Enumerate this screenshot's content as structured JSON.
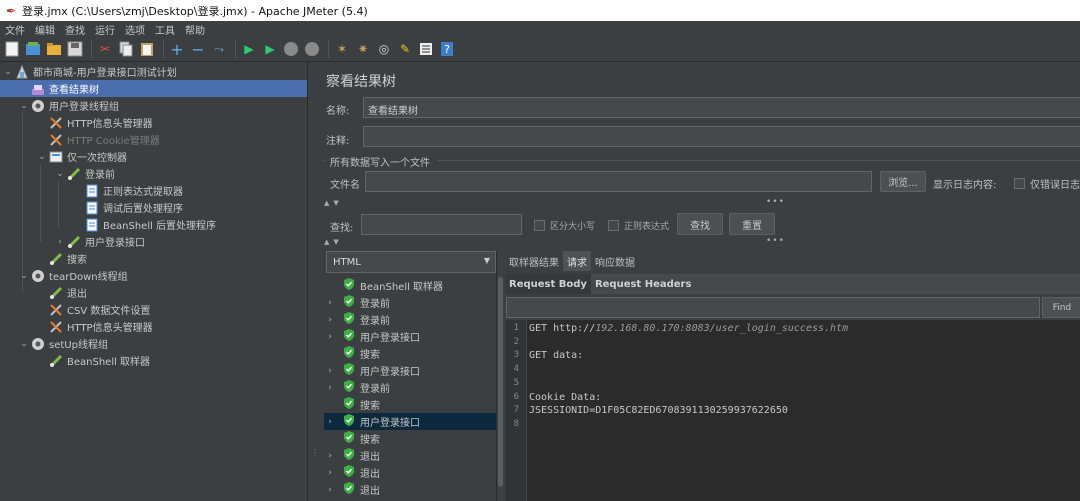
{
  "window": {
    "title": "登录.jmx (C:\\Users\\zmj\\Desktop\\登录.jmx) - Apache JMeter (5.4)"
  },
  "menu": [
    "文件",
    "编辑",
    "查找",
    "运行",
    "选项",
    "工具",
    "帮助"
  ],
  "toolbar": [
    "new-icon",
    "templates-icon",
    "open-icon",
    "save-icon",
    "cut-icon",
    "copy-icon",
    "paste-icon",
    "expand-icon",
    "collapse-icon",
    "toggle-icon",
    "start-icon",
    "start-no-pause-icon",
    "stop-icon",
    "shutdown-icon",
    "clear-icon",
    "clear-all-icon",
    "search-icon",
    "reset-search-icon",
    "function-helper-icon",
    "help-icon"
  ],
  "tree": [
    {
      "label": "都市商城-用户登录接口测试计划",
      "level": 0,
      "twisty": "open",
      "icon": "test-plan-icon"
    },
    {
      "label": "查看结果树",
      "level": 1,
      "twisty": "",
      "icon": "listener-icon",
      "selected": true
    },
    {
      "label": "用户登录线程组",
      "level": 1,
      "twisty": "open",
      "icon": "thread-group-icon"
    },
    {
      "label": "HTTP信息头管理器",
      "level": 2,
      "twisty": "",
      "icon": "config-icon"
    },
    {
      "label": "HTTP Cookie管理器",
      "level": 2,
      "twisty": "",
      "icon": "config-icon",
      "disabled": true
    },
    {
      "label": "仅一次控制器",
      "level": 2,
      "twisty": "open",
      "icon": "controller-icon"
    },
    {
      "label": "登录前",
      "level": 3,
      "twisty": "open",
      "icon": "sampler-icon"
    },
    {
      "label": "正则表达式提取器",
      "level": 4,
      "twisty": "",
      "icon": "post-processor-icon"
    },
    {
      "label": "调试后置处理程序",
      "level": 4,
      "twisty": "",
      "icon": "post-processor-icon"
    },
    {
      "label": "BeanShell 后置处理程序",
      "level": 4,
      "twisty": "",
      "icon": "post-processor-icon"
    },
    {
      "label": "用户登录接口",
      "level": 3,
      "twisty": "closed",
      "icon": "sampler-icon"
    },
    {
      "label": "搜索",
      "level": 2,
      "twisty": "",
      "icon": "sampler-icon"
    },
    {
      "label": "tearDown线程组",
      "level": 1,
      "twisty": "open",
      "icon": "thread-group-icon"
    },
    {
      "label": "退出",
      "level": 2,
      "twisty": "",
      "icon": "sampler-icon"
    },
    {
      "label": "CSV 数据文件设置",
      "level": 2,
      "twisty": "",
      "icon": "config-icon"
    },
    {
      "label": "HTTP信息头管理器",
      "level": 2,
      "twisty": "",
      "icon": "config-icon"
    },
    {
      "label": "setUp线程组",
      "level": 1,
      "twisty": "open",
      "icon": "thread-group-icon"
    },
    {
      "label": "BeanShell 取样器",
      "level": 2,
      "twisty": "",
      "icon": "sampler-icon"
    }
  ],
  "panel": {
    "title": "察看结果树",
    "name_label": "名称:",
    "name_value": "查看结果树",
    "comment_label": "注释:",
    "comment_value": "",
    "file_group_label": "所有数据写入一个文件",
    "filename_label": "文件名",
    "filename_value": "",
    "browse_label": "浏览...",
    "log_content_label": "显示日志内容:",
    "errors_only_label": "仅错误日志",
    "search_label": "查找:",
    "search_value": "",
    "case_sensitive_label": "区分大小写",
    "regex_label": "正则表达式",
    "find_label": "查找",
    "reset_label": "重置"
  },
  "results": {
    "renderer": "HTML",
    "items": [
      {
        "label": "BeanShell 取样器",
        "expandable": false,
        "status": "success"
      },
      {
        "label": "登录前",
        "expandable": true,
        "status": "success"
      },
      {
        "label": "登录前",
        "expandable": true,
        "status": "success"
      },
      {
        "label": "用户登录接口",
        "expandable": true,
        "status": "success"
      },
      {
        "label": "搜索",
        "expandable": false,
        "status": "success"
      },
      {
        "label": "用户登录接口",
        "expandable": true,
        "status": "success"
      },
      {
        "label": "登录前",
        "expandable": true,
        "status": "success"
      },
      {
        "label": "搜索",
        "expandable": false,
        "status": "success"
      },
      {
        "label": "用户登录接口",
        "expandable": true,
        "status": "success",
        "selected": true
      },
      {
        "label": "搜索",
        "expandable": false,
        "status": "success"
      },
      {
        "label": "退出",
        "expandable": true,
        "status": "success"
      },
      {
        "label": "退出",
        "expandable": true,
        "status": "success"
      },
      {
        "label": "退出",
        "expandable": true,
        "status": "success"
      }
    ]
  },
  "detail": {
    "tabs": [
      "取样器结果",
      "请求",
      "响应数据"
    ],
    "active_tab": 1,
    "subtabs": [
      "Request Body",
      "Request Headers"
    ],
    "active_subtab": 0,
    "find_label": "Find",
    "lines": [
      {
        "n": "1",
        "text": "GET http://",
        "url": "192.168.80.170:8083/user_login_success.htm"
      },
      {
        "n": "2",
        "text": "",
        "url": ""
      },
      {
        "n": "3",
        "text": "GET data:",
        "url": ""
      },
      {
        "n": "4",
        "text": "",
        "url": ""
      },
      {
        "n": "5",
        "text": "",
        "url": ""
      },
      {
        "n": "6",
        "text": "Cookie Data:",
        "url": ""
      },
      {
        "n": "7",
        "text": "JSESSIONID=D1F05C82ED6708391130259937622650",
        "url": ""
      },
      {
        "n": "8",
        "text": "",
        "url": ""
      }
    ]
  },
  "colors": {
    "background": "#3c3f41",
    "selection": "#4b6eaf",
    "success": "#3cb043",
    "editor_bg": "#2b2b2b"
  }
}
